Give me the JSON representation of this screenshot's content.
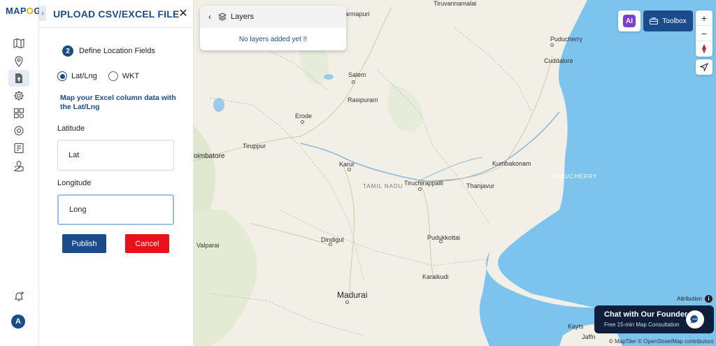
{
  "app": {
    "logo_prefix": "MAP",
    "logo_o": "O",
    "logo_suffix": "G"
  },
  "colors": {
    "brand": "#1a4c8b",
    "danger": "#e8101a",
    "sea": "#7cc3ee",
    "land": "#f2efe6"
  },
  "rail": {
    "icons": [
      "map-icon",
      "location-pin-icon",
      "upload-file-icon",
      "settings-gear-icon",
      "layers-grid-icon",
      "target-icon",
      "checklist-icon",
      "map-share-icon"
    ],
    "notification_icon": "bell-icon",
    "avatar_letter": "A"
  },
  "panel": {
    "collapse_glyph": "›",
    "title": "UPLOAD CSV/EXCEL FILE",
    "close_glyph": "✕",
    "step_number": "2",
    "step_label": "Define Location Fields",
    "options": [
      {
        "label": "Lat/Lng",
        "selected": true
      },
      {
        "label": "WKT",
        "selected": false
      }
    ],
    "hint": "Map your Excel column data with the Lat/Lng",
    "latitude_label": "Latitude",
    "latitude_value": "Lat",
    "longitude_label": "Longitude",
    "longitude_value": "Long",
    "publish_label": "Publish",
    "cancel_label": "Cancel"
  },
  "layers": {
    "back_glyph": "‹",
    "title": "Layers",
    "empty_text": "No layers added yet !!"
  },
  "toolbar": {
    "ai_label": "AI",
    "toolbox_label": "Toolbox",
    "zoom_in": "+",
    "zoom_out": "−"
  },
  "map": {
    "places": {
      "tiruvannamalai": "Tiruvannamalai",
      "dharmapuri": "harmapuri",
      "puducherry": "Puducherry",
      "cuddalore": "Cuddalore",
      "salem": "Salem",
      "rasipuram": "Rasipuram",
      "erode": "Erode",
      "tiruppur": "Tiruppur",
      "coimbatore": "oimbatore",
      "karur": "Karur",
      "tamil_nadu": "TAMIL NADU",
      "tiruchirappalli": "Tiruchirappalli",
      "kumbakonam": "Kumbakonam",
      "thanjavur": "Thanjavur",
      "puducherry_region": "PUDUCHERRY",
      "valparai": "Valparai",
      "dindigul": "Dindigul",
      "pudukkottai": "Pudukkottai",
      "karaikudi": "Karaikudi",
      "madurai": "Madurai",
      "kayts": "Kayts",
      "jaffna": "Jaffn"
    },
    "attribution_label": "Attribution",
    "copyright": "© MapTiler © OpenStreetMap contributors"
  },
  "chat": {
    "title": "Chat with Our Founder",
    "subtitle": "Free 15-min Map Consultation"
  }
}
